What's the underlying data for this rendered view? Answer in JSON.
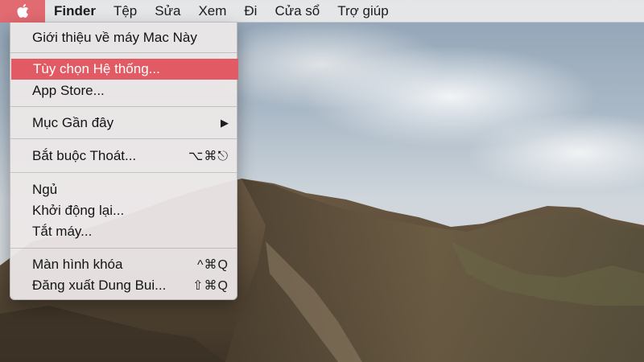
{
  "menubar": {
    "apple_icon": "apple-logo-icon",
    "app_name": "Finder",
    "items": [
      "Tệp",
      "Sửa",
      "Xem",
      "Đi",
      "Cửa sổ",
      "Trợ giúp"
    ]
  },
  "apple_menu": {
    "about": "Giới thiệu về máy Mac Này",
    "system_preferences": "Tùy chọn Hệ thống...",
    "app_store": "App Store...",
    "recent_items": "Mục Gần đây",
    "recent_items_arrow": "▶",
    "force_quit": "Bắt buộc Thoát...",
    "force_quit_shortcut": "⌥⌘⎋",
    "sleep": "Ngủ",
    "restart": "Khởi động lại...",
    "shut_down": "Tắt máy...",
    "lock_screen": "Màn hình khóa",
    "lock_screen_shortcut": "^⌘Q",
    "log_out": "Đăng xuất Dung Bui...",
    "log_out_shortcut": "⇧⌘Q"
  },
  "colors": {
    "highlight": "#e15a64",
    "apple_active": "#e26a71",
    "menu_bg": "#ece8e8"
  }
}
